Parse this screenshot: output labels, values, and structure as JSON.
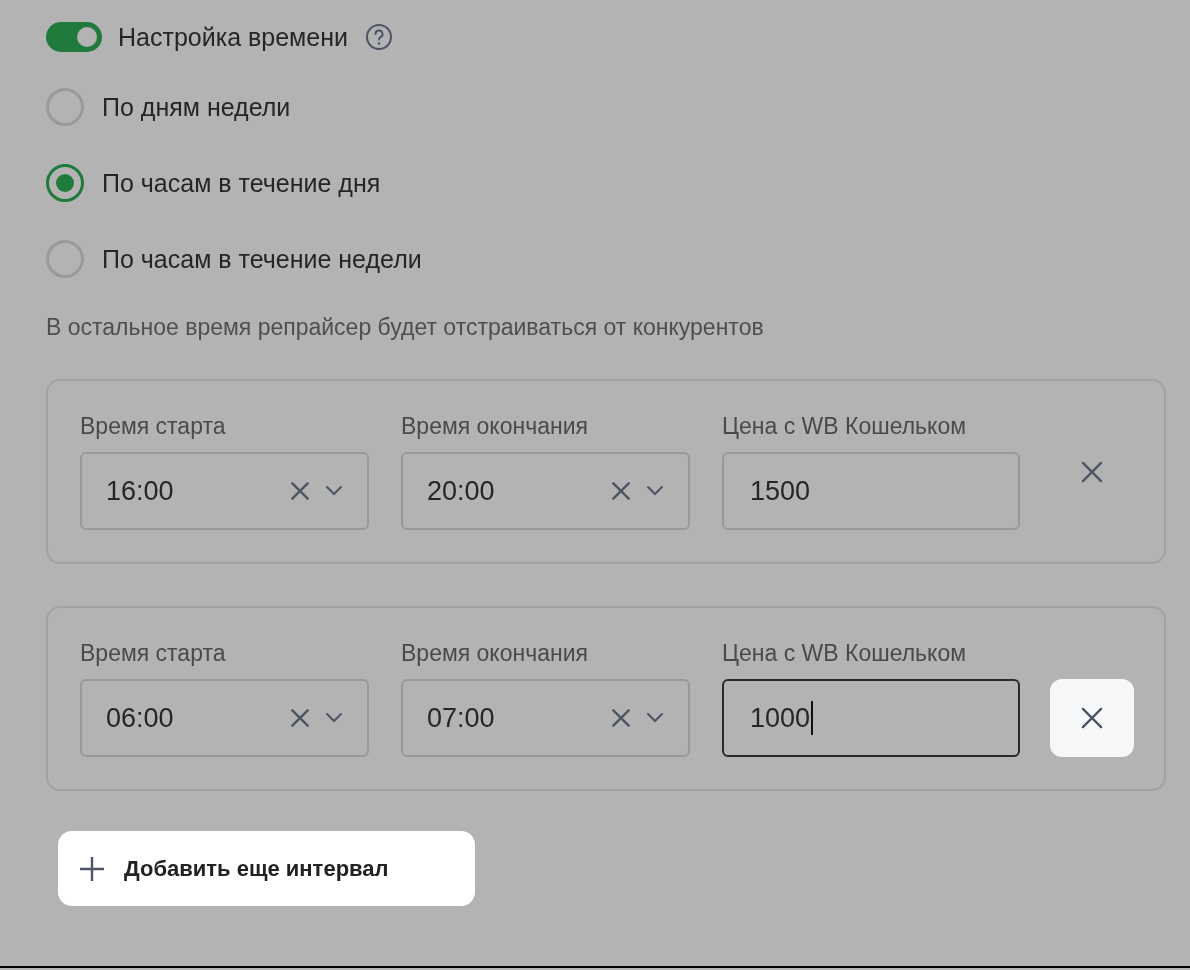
{
  "time_setting": {
    "label": "Настройка времени",
    "on": true
  },
  "modes": [
    {
      "label": "По дням недели",
      "selected": false
    },
    {
      "label": "По часам в течение дня",
      "selected": true
    },
    {
      "label": "По часам в течение недели",
      "selected": false
    }
  ],
  "note": "В остальное время репрайсер будет отстраиваться от конкурентов",
  "intervals": [
    {
      "start_label": "Время старта",
      "start": "16:00",
      "end_label": "Время окончания",
      "end": "20:00",
      "price_label": "Цена с WB Кошельком",
      "price": "1500",
      "price_focused": false,
      "remove_highlighted": false
    },
    {
      "start_label": "Время старта",
      "start": "06:00",
      "end_label": "Время окончания",
      "end": "07:00",
      "price_label": "Цена с WB Кошельком",
      "price": "1000",
      "price_focused": true,
      "remove_highlighted": true
    }
  ],
  "add_button": {
    "label": "Добавить еще интервал",
    "highlighted": true
  }
}
